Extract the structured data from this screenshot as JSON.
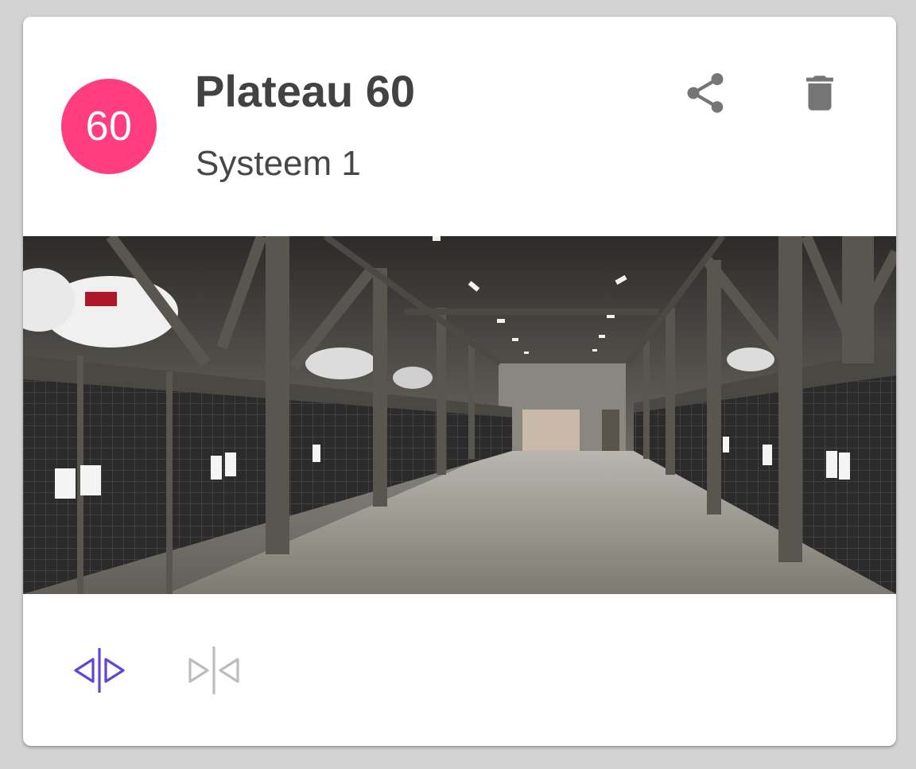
{
  "card": {
    "badge_number": "60",
    "title": "Plateau 60",
    "subtitle": "Systeem 1"
  },
  "header_actions": {
    "share_icon": "share-icon",
    "delete_icon": "trash-icon"
  },
  "photo": {
    "subject": "parking-garage-interior"
  },
  "footer_actions": {
    "expand_icon": "split-expand-icon",
    "collapse_icon": "split-collapse-icon"
  },
  "colors": {
    "badge": "#ff3d7f",
    "icon_gray": "#757575",
    "active_action": "#5b48d6",
    "disabled_action": "#bdbdbd",
    "title_text": "#424242"
  }
}
